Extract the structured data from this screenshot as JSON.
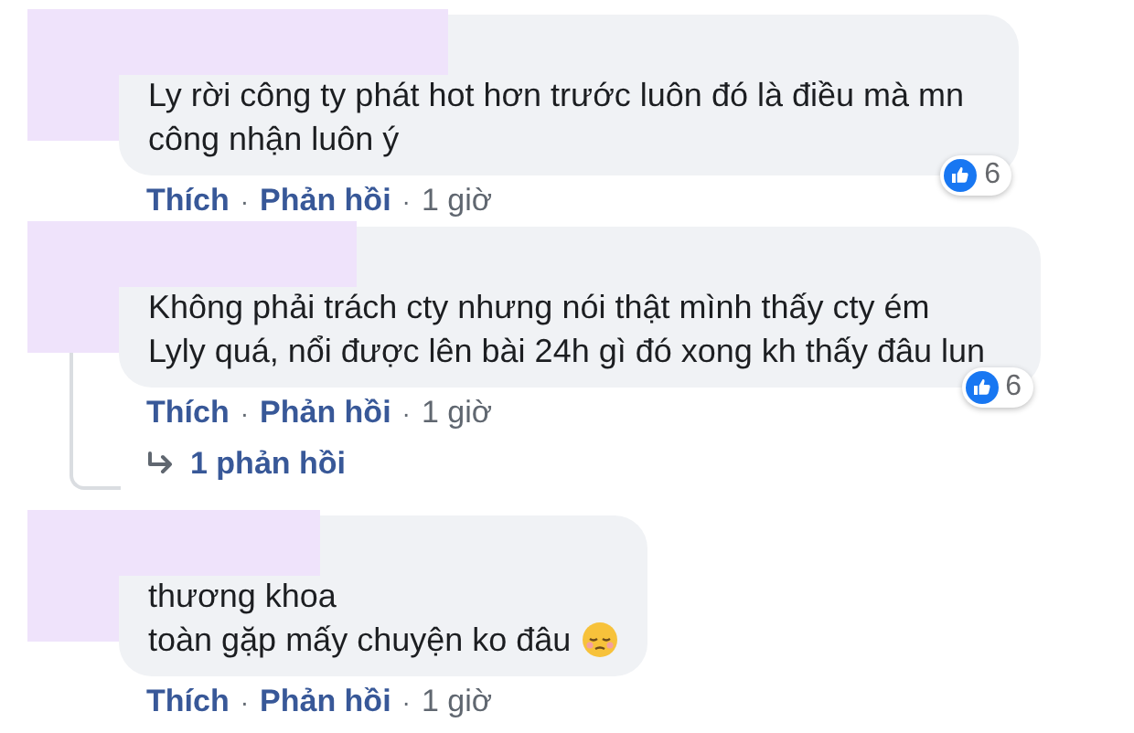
{
  "comments": [
    {
      "lines": [
        "Ly rời công ty phát hot hơn trước luôn đó là điều mà mn",
        "công nhận luôn ý"
      ],
      "emoji": false,
      "reaction_count": "6",
      "actions": [
        "Thích",
        "Phản hồi"
      ],
      "separator": "·",
      "time": "1 giờ"
    },
    {
      "lines": [
        "Không phải trách cty nhưng nói thật mình thấy cty ém",
        "Lyly quá, nổi được lên bài 24h gì đó xong kh thấy đâu lun"
      ],
      "emoji": false,
      "reaction_count": "6",
      "actions": [
        "Thích",
        "Phản hồi"
      ],
      "separator": "·",
      "time": "1 giờ",
      "replies_link": "1 phản hồi"
    },
    {
      "lines": [
        "thương khoa",
        "toàn gặp mấy chuyện ko đâu"
      ],
      "emoji": true,
      "actions": [
        "Thích",
        "Phản hồi"
      ],
      "separator": "·",
      "time": "1 giờ"
    }
  ]
}
